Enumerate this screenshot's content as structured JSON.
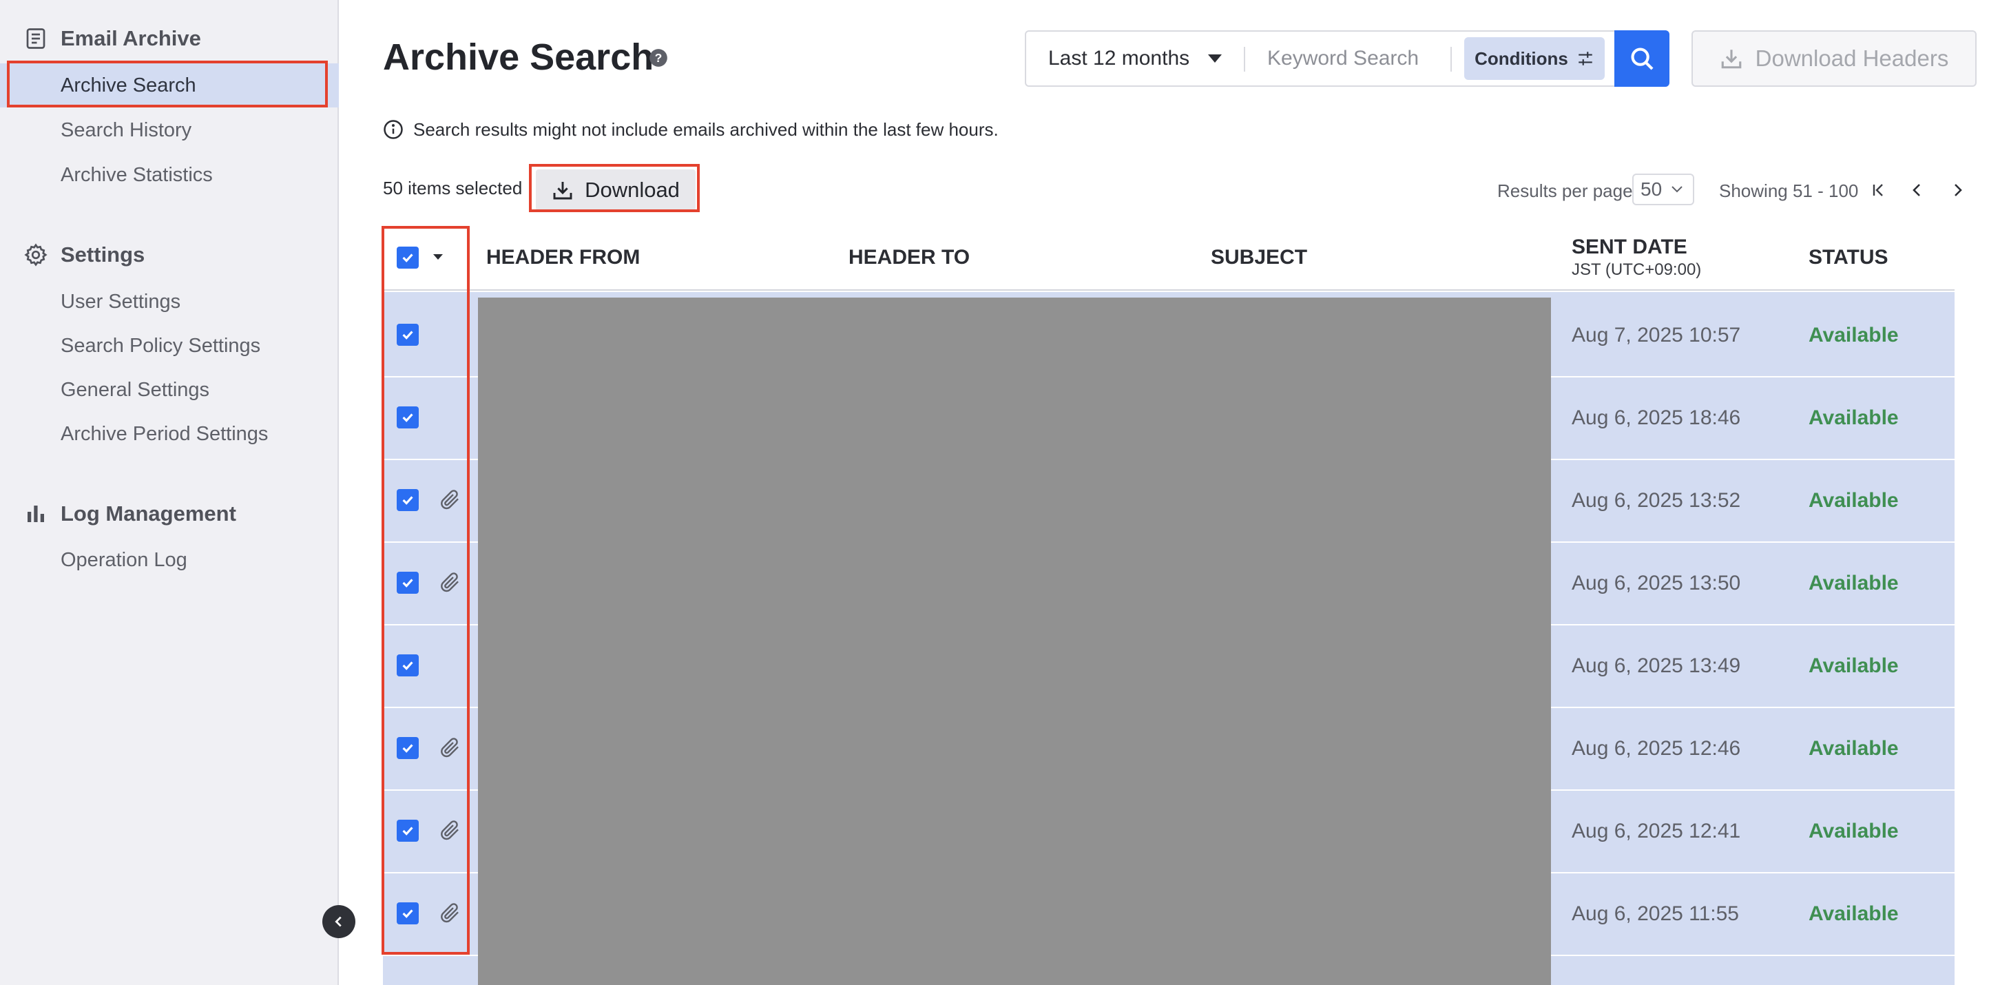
{
  "sidebar": {
    "sections": [
      {
        "title": "Email Archive",
        "icon": "archive-icon",
        "items": [
          "Archive Search",
          "Search History",
          "Archive Statistics"
        ]
      },
      {
        "title": "Settings",
        "icon": "gear-icon",
        "items": [
          "User Settings",
          "Search Policy Settings",
          "General Settings",
          "Archive Period Settings"
        ]
      },
      {
        "title": "Log Management",
        "icon": "bar-chart-icon",
        "items": [
          "Operation Log"
        ]
      }
    ],
    "active_item": "Archive Search"
  },
  "header": {
    "title": "Archive Search",
    "period": "Last 12 months",
    "keyword_placeholder": "Keyword Search",
    "conditions_label": "Conditions",
    "download_headers_label": "Download Headers"
  },
  "notice": "Search results might not include emails archived within the last few hours.",
  "toolbar": {
    "selected_count": "50 items selected",
    "download_label": "Download",
    "results_per_page_label": "Results per page",
    "results_per_page": "50",
    "showing": "Showing 51 - 100"
  },
  "table": {
    "columns": {
      "from": "HEADER FROM",
      "to": "HEADER TO",
      "subject": "SUBJECT",
      "sent_date": "SENT DATE",
      "sent_date_tz": "JST (UTC+09:00)",
      "status": "STATUS"
    },
    "rows": [
      {
        "checked": true,
        "attachment": false,
        "sent": "Aug 7, 2025 10:57",
        "status": "Available"
      },
      {
        "checked": true,
        "attachment": false,
        "sent": "Aug 6, 2025 18:46",
        "status": "Available"
      },
      {
        "checked": true,
        "attachment": true,
        "sent": "Aug 6, 2025 13:52",
        "status": "Available"
      },
      {
        "checked": true,
        "attachment": true,
        "sent": "Aug 6, 2025 13:50",
        "status": "Available"
      },
      {
        "checked": true,
        "attachment": false,
        "sent": "Aug 6, 2025 13:49",
        "status": "Available"
      },
      {
        "checked": true,
        "attachment": true,
        "sent": "Aug 6, 2025 12:46",
        "status": "Available"
      },
      {
        "checked": true,
        "attachment": true,
        "sent": "Aug 6, 2025 12:41",
        "status": "Available"
      },
      {
        "checked": true,
        "attachment": true,
        "sent": "Aug 6, 2025 11:55",
        "status": "Available"
      }
    ]
  },
  "colors": {
    "accent": "#2b6ef2",
    "selection": "#d3dcf2",
    "status_available": "#3f8f52",
    "highlight_box": "#e4412e"
  }
}
